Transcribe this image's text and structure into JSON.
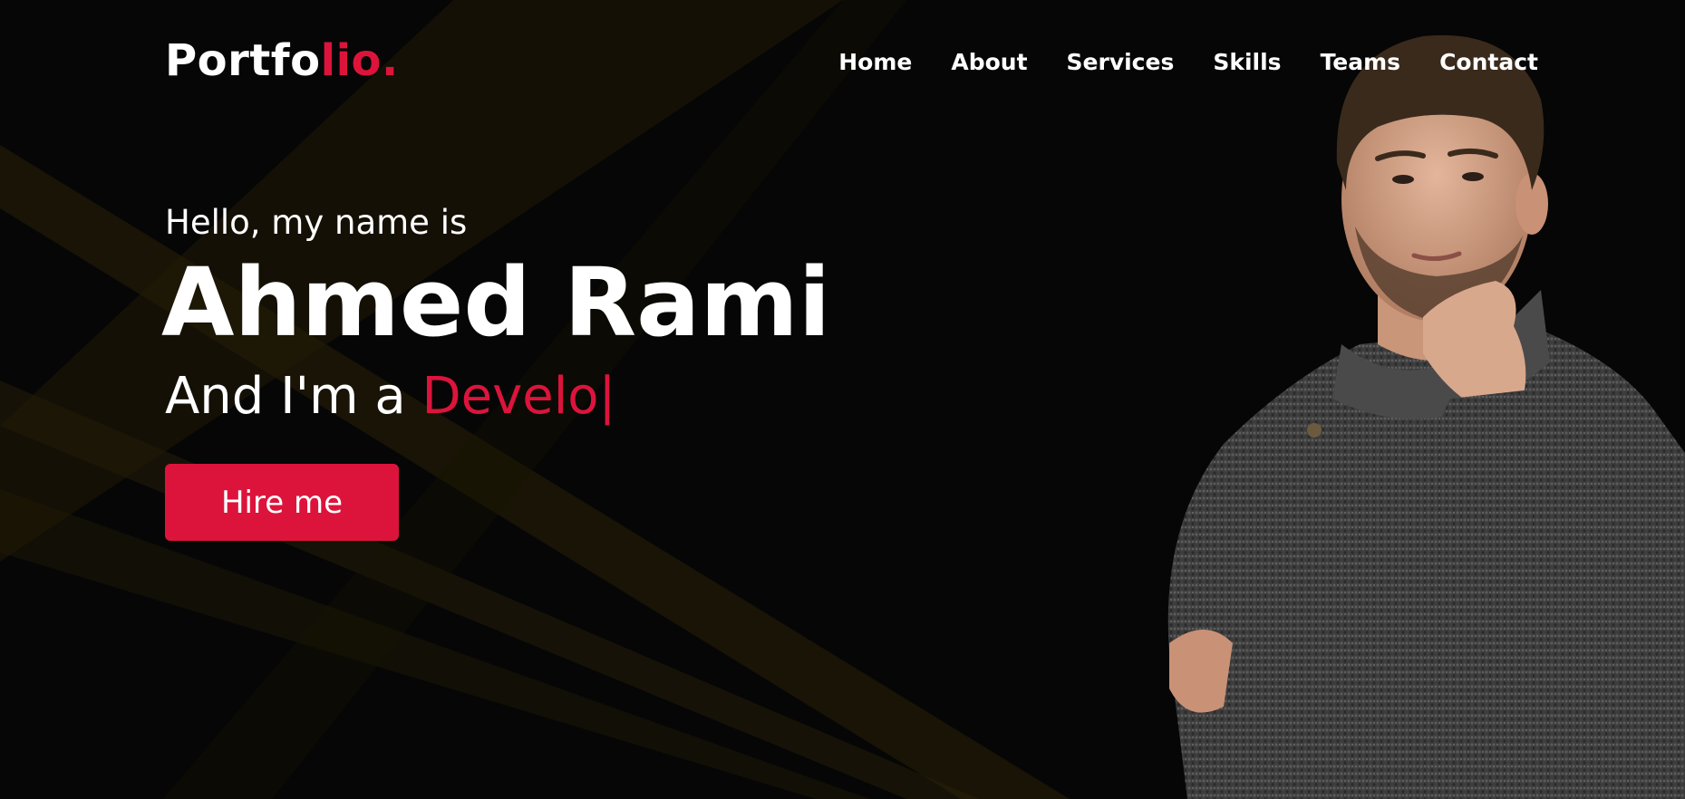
{
  "header": {
    "logo_main": "Portfo",
    "logo_accent": "lio."
  },
  "nav": {
    "items": [
      {
        "label": "Home"
      },
      {
        "label": "About"
      },
      {
        "label": "Services"
      },
      {
        "label": "Skills"
      },
      {
        "label": "Teams"
      },
      {
        "label": "Contact"
      }
    ]
  },
  "hero": {
    "greeting": "Hello, my name is",
    "name": "Ahmed Rami",
    "role_prefix": "And I'm a ",
    "role_typed": "Develo",
    "caret": "|",
    "cta_label": "Hire me"
  },
  "colors": {
    "accent": "#dc143c",
    "background": "#060606",
    "text": "#ffffff"
  },
  "icons": {
    "portrait": "person-portrait-image"
  }
}
